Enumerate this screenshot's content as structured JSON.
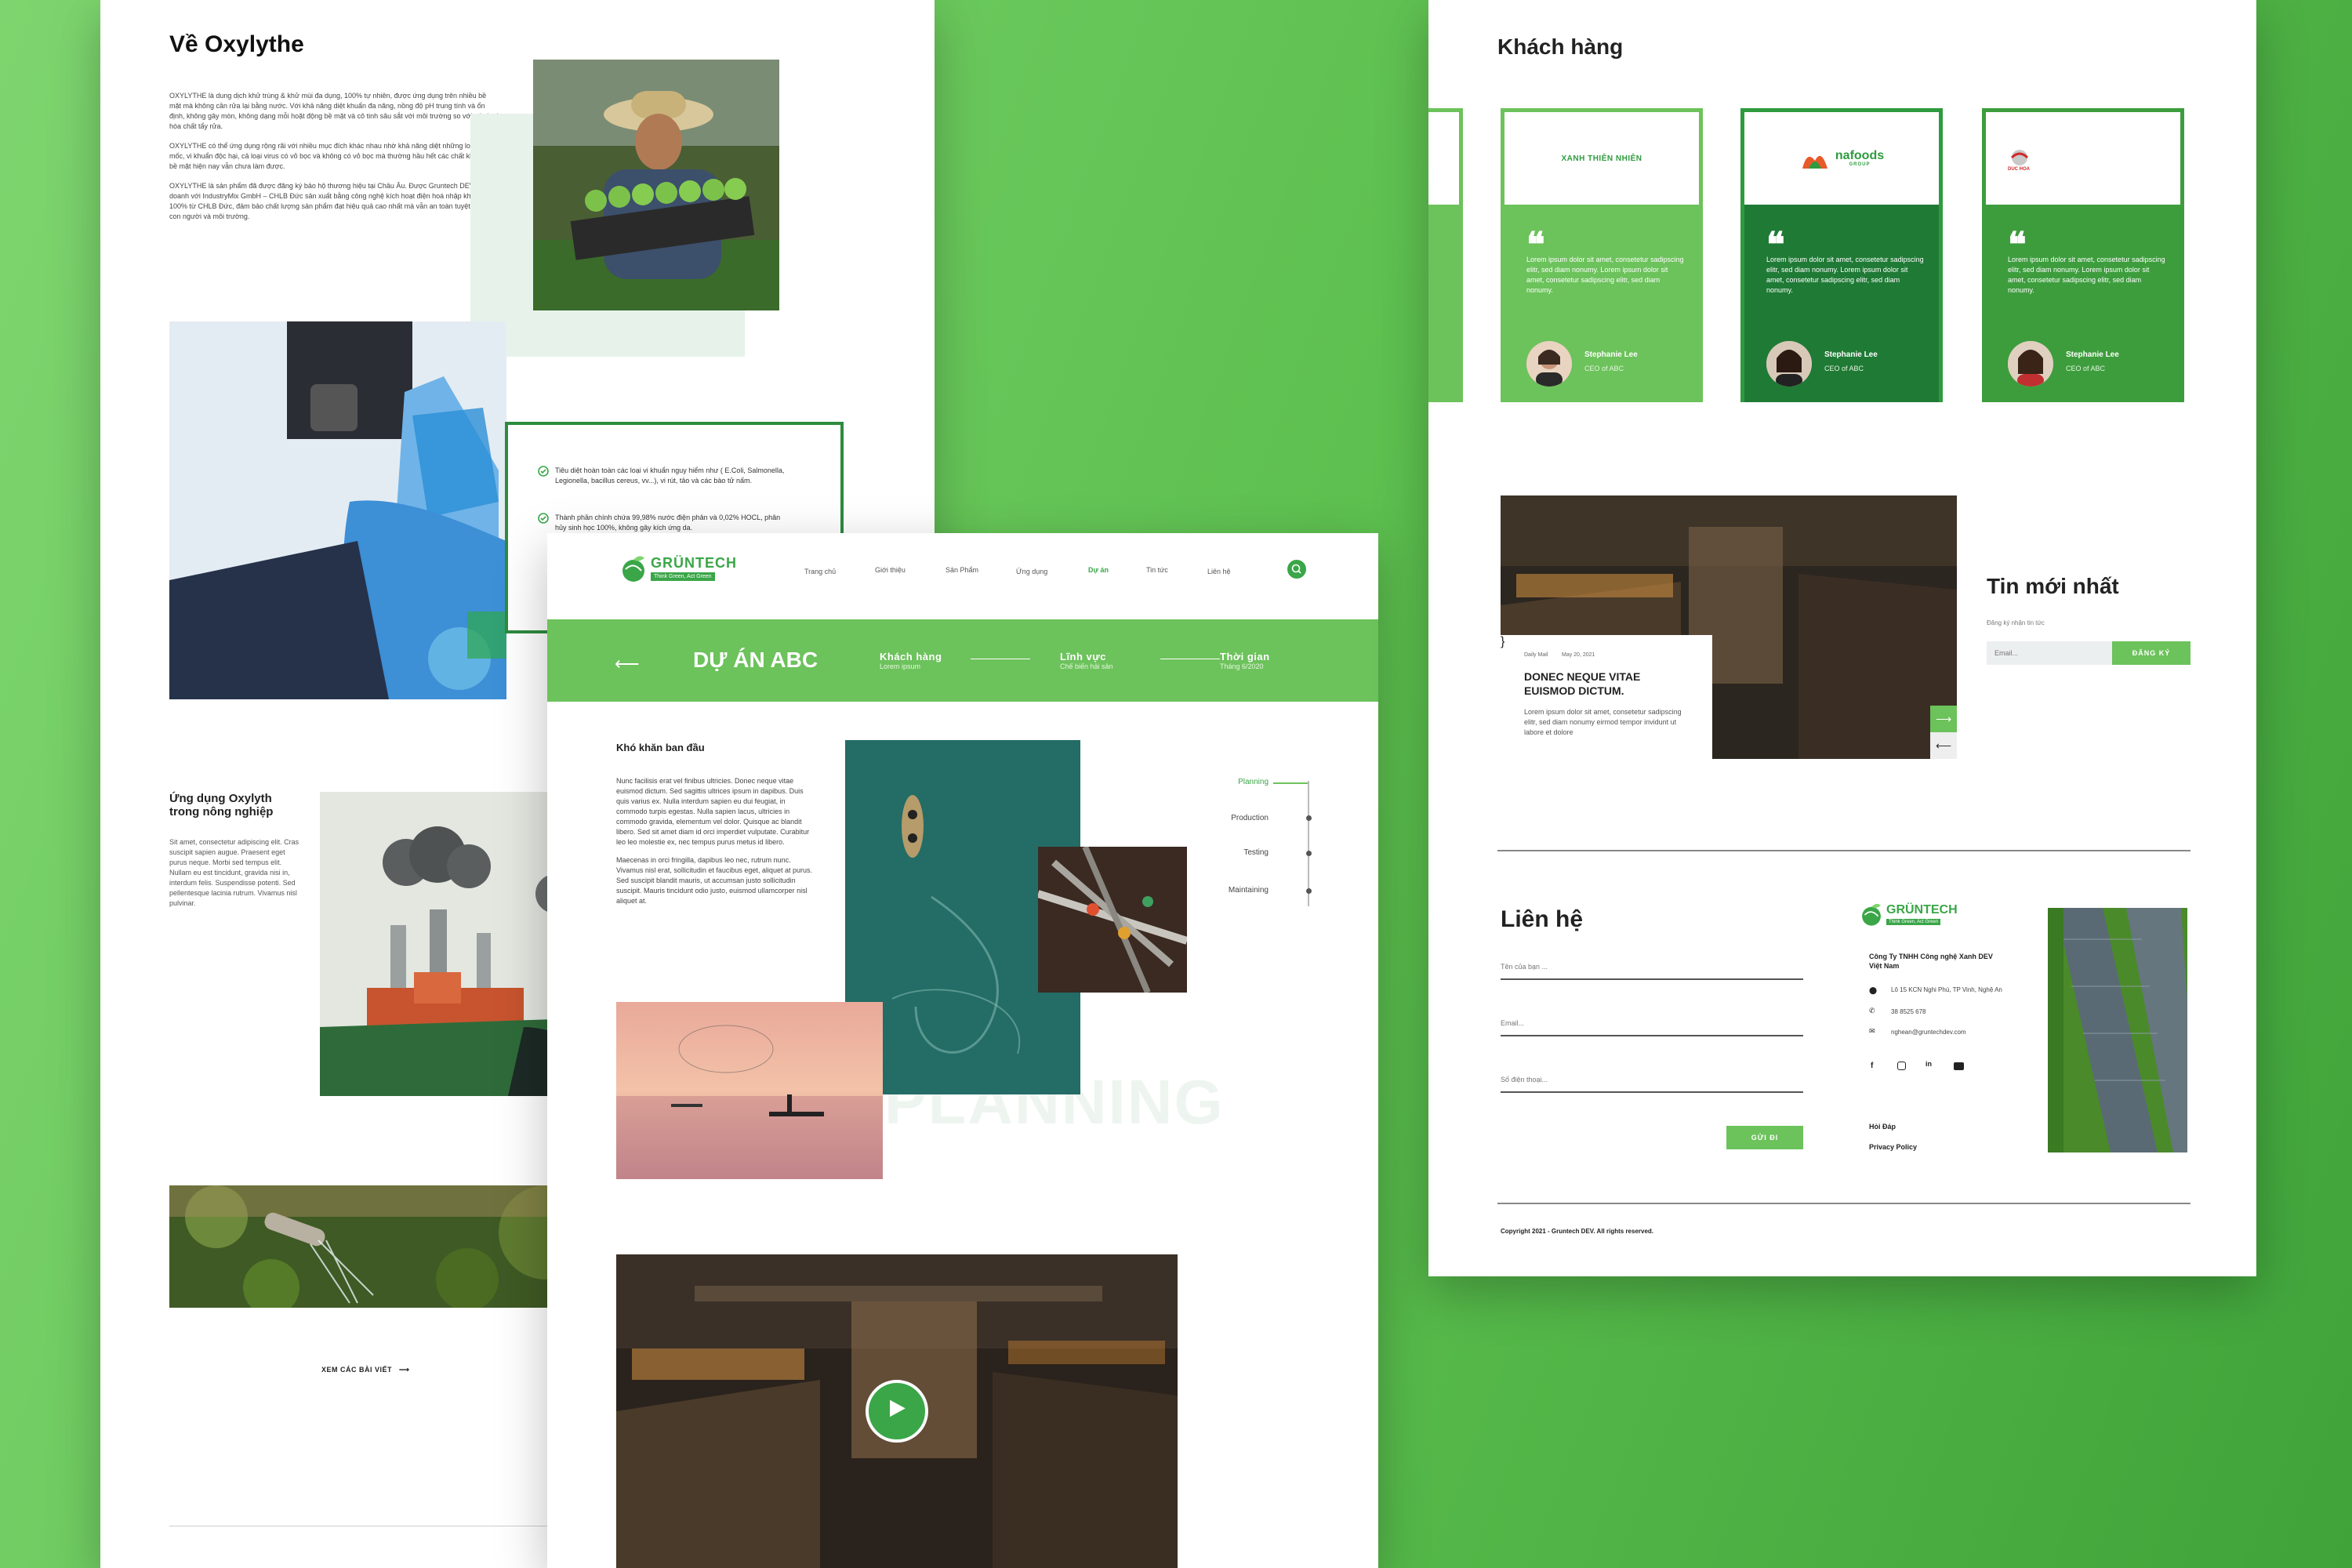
{
  "left": {
    "about_title": "Về Oxylythe",
    "about_paragraphs": [
      "OXYLYTHE là dung dịch khử trùng & khử mùi đa dụng, 100% tự nhiên, được ứng dụng trên nhiều bề mặt mà không cần rửa lại bằng nước. Với khả năng diệt khuẩn đa năng, nồng độ pH trung tính và ổn định, không gây mòn, không dạng mỗi hoặt động bề mặt và cô tinh sâu sắt với môi trường so với các loại hóa chất tẩy rửa.",
      "OXYLYTHE có thể ứng dụng rộng rãi với nhiều mục đích khác nhau nhờ khả năng diệt những loại nấm mốc, vi khuẩn độc hại, cả loại virus có vỏ bọc và không có vỏ bọc mà thường hầu hết các chất khử trùng bề mặt hiện nay vẫn chưa làm được.",
      "OXYLYTHE là sản phẩm đã được đăng ký bảo hộ thương hiệu tại Châu Âu. Được Gruntech DEV liên doanh với IndustryMix GmbH – CHLB Đức sản xuất bằng công nghệ kích hoạt điện hoá nhập khẩu 100% từ CHLB Đức, đảm bảo chất lượng sản phẩm đạt hiệu quả cao nhất mà vẫn an toàn tuyệt đối với con người và môi trường."
    ],
    "checks": [
      "Tiêu diệt hoàn toàn các loại vi khuẩn nguy hiểm như ( E.Coli, Salmonella, Legionella, bacillus cereus, vv...), vi rút, tảo và các bào tử nấm.",
      "Thành phần chính chứa 99,98% nước điện phân và 0,02% HOCL, phân hủy sinh học 100%, không gây kích ứng da."
    ],
    "app_title": "Ứng dụng Oxylyth trong nông nghiệp",
    "app_text": "Sit amet, consectetur adipiscing elit. Cras suscipit sapien augue. Praesent eget purus neque. Morbi sed tempus elit. Nullam eu est tincidunt, gravida nisi in, interdum felis. Suspendisse potenti. Sed pellentesque lacinia rutrum. Vivamus nisl pulvinar.",
    "more_link": "XEM CÁC BÀI VIẾT"
  },
  "mid": {
    "logo_text": "GRÜNTECH",
    "logo_sub": "Think Green, Act Green",
    "nav": [
      "Trang chủ",
      "Giới thiệu",
      "Sản Phẩm",
      "Ứng dụng",
      "Dự án",
      "Tin tức",
      "Liên hệ"
    ],
    "nav_active": "Dự án",
    "project_title": "DỰ ÁN ABC",
    "meta": [
      {
        "label": "Khách hàng",
        "value": "Lorem ipsum"
      },
      {
        "label": "Lĩnh vực",
        "value": "Chế biến hải sản"
      },
      {
        "label": "Thời gian",
        "value": "Tháng 6/2020"
      }
    ],
    "challenge_title": "Khó khăn ban đầu",
    "challenge_p1": "Nunc facilisis erat vel finibus ultricies. Donec neque vitae euismod dictum. Sed sagittis ultrices ipsum in dapibus. Duis quis varius ex. Nulla interdum sapien eu dui feugiat, in commodo turpis egestas. Nulla sapien lacus, ultricies in commodo gravida, elementum vel dolor. Quisque ac blandit libero. Sed sit amet diam id orci imperdiet vulputate. Curabitur leo leo molestie ex, nec tempus purus metus id libero.",
    "challenge_p2": "Maecenas in orci fringilla, dapibus leo nec, rutrum nunc. Vivamus nisl erat, sollicitudin et faucibus eget, aliquet at purus. Sed suscipit blandit mauris, ut accumsan justo sollicitudin suscipit. Mauris tincidunt odio justo, euismod ullamcorper nisl aliquet at.",
    "timeline": [
      "Planning",
      "Production",
      "Testing",
      "Maintaining"
    ],
    "watermark": "PLANNING"
  },
  "right": {
    "clients_title": "Khách hàng",
    "clients": [
      {
        "logo": "XANH THIÊN NHIÊN",
        "color": "#6cc25b",
        "text": "Lorem ipsum dolor sit amet, consetetur sadipscing elitr, sed diam nonumy. Lorem ipsum dolor sit amet, consetetur sadipscing elitr, sed diam nonumy.",
        "name": "Stephanie Lee",
        "role": "CEO of ABC"
      },
      {
        "logo": "nafoods",
        "logo_sub": "GROUP",
        "color": "#1f7a35",
        "text": "Lorem ipsum dolor sit amet, consetetur sadipscing elitr, sed diam nonumy. Lorem ipsum dolor sit amet, consetetur sadipscing elitr, sed diam nonumy.",
        "name": "Stephanie Lee",
        "role": "CEO of ABC"
      },
      {
        "logo": "DUC HOA",
        "color": "#3d9d3d",
        "text": "Lorem ipsum dolor sit amet, consetetur sadipscing elitr, sed diam nonumy. Lorem ipsum dolor sit amet, consetetur sadipscing elitr, sed diam nonumy.",
        "name": "Stephanie Lee",
        "role": "CEO of ABC"
      }
    ],
    "news_meta_cat": "Daily Mail",
    "news_meta_date": "May 20, 2021",
    "news_title": "DONEC  NEQUE VITAE EUISMOD DICTUM.",
    "news_text": "Lorem ipsum dolor sit amet, consetetur sadipscing elitr, sed diam nonumy eirmod tempor invidunt ut labore et dolore",
    "latest_title": "Tin mới nhất",
    "latest_sub": "Đăng ký nhận tin tức",
    "email_placeholder": "Email...",
    "subscribe_label": "ĐĂNG KÝ",
    "contact_title": "Liên hệ",
    "field_name": "Tên của bạn ...",
    "field_email": "Email...",
    "field_phone": "Số điện thoại...",
    "send_label": "GỬI ĐI",
    "company": "Công Ty TNHH Công nghệ Xanh DEV Việt Nam",
    "address": "Lô 15 KCN Nghi Phú, TP Vinh, Nghệ An",
    "phone": "38 8525 678",
    "email": "nghean@gruntechdev.com",
    "links": [
      "Hỏi Đáp",
      "Privacy Policy"
    ],
    "copyright": "Copyright 2021 - Gruntech DEV. All rights reserved.",
    "logo_text": "GRÜNTECH",
    "logo_sub": "Think Green, Act Green"
  },
  "colors": {
    "green": "#6cc25b",
    "dark_green": "#1f7a35",
    "mid_green": "#3d9d3d"
  }
}
